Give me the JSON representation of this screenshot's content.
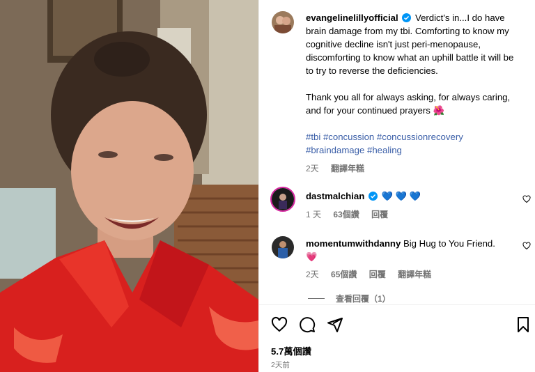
{
  "post": {
    "author": "evangelinelillyofficial",
    "caption_p1": "Verdict's in...I do have brain damage from my tbi. Comforting to know my cognitive decline isn't just peri-menopause, discomforting to know what an uphill battle it will be to try to reverse the deficiencies.",
    "caption_p2": "Thank you all for always asking, for always caring, and for your continued prayers 🌺",
    "hashtags": [
      "#tbi",
      "#concussion",
      "#concussionrecovery",
      "#braindamage",
      "#healing"
    ],
    "time": "2天",
    "translate_label": "翻譯年糕"
  },
  "comments": [
    {
      "username": "dastmalchian",
      "text": "💙 💙 💙",
      "time": "1 天",
      "likes": "63個讚",
      "reply_label": "回覆"
    },
    {
      "username": "momentumwithdanny",
      "text": "Big Hug to You Friend.",
      "emoji": "💗",
      "time": "2天",
      "likes": "65個讚",
      "reply_label": "回覆",
      "translate_label": "翻譯年糕",
      "view_replies": "查看回覆（1）"
    }
  ],
  "footer": {
    "likes": "5.7萬個讚",
    "time_ago": "2天前"
  },
  "colors": {
    "hashtag": "#3b5fa8",
    "verified": "#0095f6",
    "meta_gray": "#737373",
    "pajama_red": "#d8201e"
  },
  "icons": [
    "verified-badge-icon",
    "heart-icon",
    "comment-icon",
    "share-icon",
    "bookmark-icon"
  ]
}
